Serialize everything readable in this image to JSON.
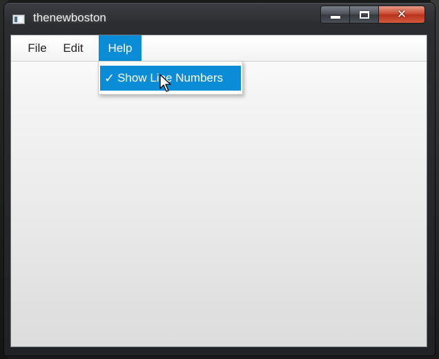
{
  "window": {
    "title": "thenewboston",
    "close_glyph": "✕",
    "icons": {
      "app": "window-app-icon",
      "minimize": "minimize-icon",
      "maximize": "maximize-icon",
      "close": "close-icon"
    }
  },
  "menubar": {
    "items": [
      {
        "label": "File"
      },
      {
        "label": "Edit"
      },
      {
        "label": "Help",
        "state": "open"
      }
    ]
  },
  "help_menu": {
    "items": [
      {
        "label": "Show Line Numbers",
        "checked": true,
        "check_glyph": "✓",
        "state": "highlighted"
      }
    ]
  },
  "colors": {
    "accent": "#0a8dd6",
    "close_button": "#c9472e",
    "titlebar": "#2b2d31",
    "client_background": "#ececec"
  },
  "cursor": {
    "icon": "mouse-pointer-icon"
  }
}
